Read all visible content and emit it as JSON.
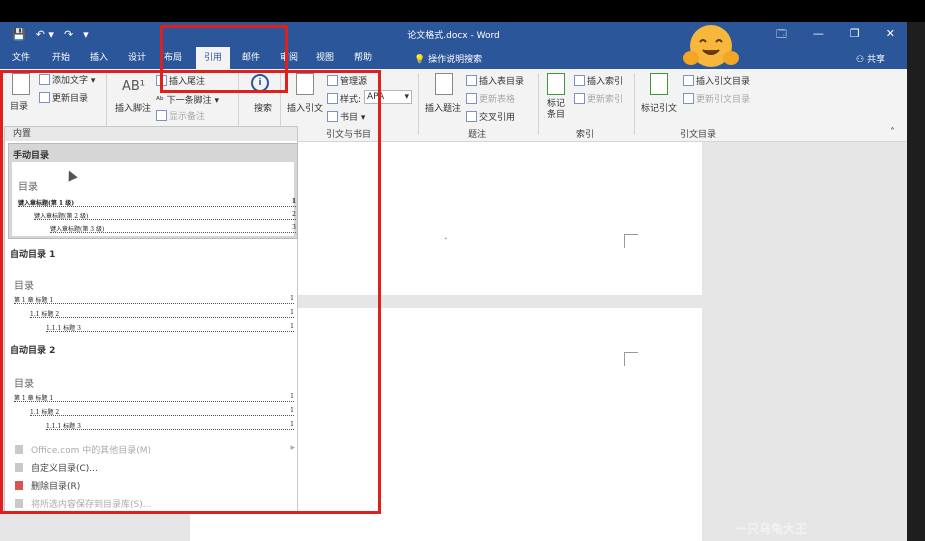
{
  "window": {
    "title": "论文格式.docx - Word",
    "controls": [
      "🗔",
      "—",
      "❐",
      "✕"
    ]
  },
  "quick_access": [
    "💾",
    "↶ ▾",
    "↷",
    "▾"
  ],
  "tabs": [
    {
      "label": "文件"
    },
    {
      "label": "开始"
    },
    {
      "label": "插入"
    },
    {
      "label": "设计"
    },
    {
      "label": "布局"
    },
    {
      "label": "引用",
      "active": true
    },
    {
      "label": "邮件"
    },
    {
      "label": "审阅"
    },
    {
      "label": "视图"
    },
    {
      "label": "帮助"
    }
  ],
  "tell_me": "操作说明搜索",
  "share": "共享",
  "ribbon": {
    "toc_button": "目录",
    "add_text": "添加文字",
    "update_toc": "更新目录",
    "insert_footnote": "插入脚注",
    "insert_endnote": "插入尾注",
    "next_footnote": "下一条脚注",
    "show_notes": "显示备注",
    "search": "搜索",
    "insert_citation": "插入引文",
    "manage_sources": "管理源",
    "style_label": "样式:",
    "style_value": "APA",
    "bibliography": "书目",
    "group_citations": "引文与书目",
    "insert_caption": "插入题注",
    "insert_table_of_figures": "插入表目录",
    "update_table": "更新表格",
    "cross_reference": "交叉引用",
    "group_captions": "题注",
    "mark_entry": "标记\n条目",
    "insert_index": "插入索引",
    "update_index": "更新索引",
    "group_index": "索引",
    "mark_citation": "标记引文",
    "insert_table_of_authorities": "插入引文目录",
    "update_table_of_authorities": "更新引文目录",
    "group_authorities": "引文目录"
  },
  "dropdown": {
    "header": "内置",
    "manual": {
      "label": "手动目录",
      "title": "目录",
      "lines": [
        {
          "text": "键入章标题(第 1 级)",
          "page": "1"
        },
        {
          "text": "键入章标题(第 2 级)",
          "page": "2"
        },
        {
          "text": "键入章标题(第 3 级)",
          "page": "3"
        }
      ]
    },
    "auto1": {
      "label": "自动目录 1",
      "title": "目录",
      "lines": [
        {
          "text": "第 1 章  标题 1",
          "page": "1"
        },
        {
          "text": "1.1  标题 2",
          "page": "1"
        },
        {
          "text": "1.1.1  标题 3",
          "page": "1"
        }
      ]
    },
    "auto2": {
      "label": "自动目录 2",
      "title": "目录",
      "lines": [
        {
          "text": "第 1 章  标题 1",
          "page": "1"
        },
        {
          "text": "1.1  标题 2",
          "page": "1"
        },
        {
          "text": "1.1.1  标题 3",
          "page": "1"
        }
      ]
    },
    "menu": [
      {
        "label": "Office.com 中的其他目录(M)",
        "disabled": true
      },
      {
        "label": "自定义目录(C)...",
        "disabled": false
      },
      {
        "label": "删除目录(R)",
        "disabled": false
      },
      {
        "label": "将所选内容保存到目录库(S)...",
        "disabled": true
      }
    ]
  },
  "watermark": "一只乌龟大王",
  "colors": {
    "word_blue": "#2b579a",
    "highlight_red": "#e0201c"
  }
}
